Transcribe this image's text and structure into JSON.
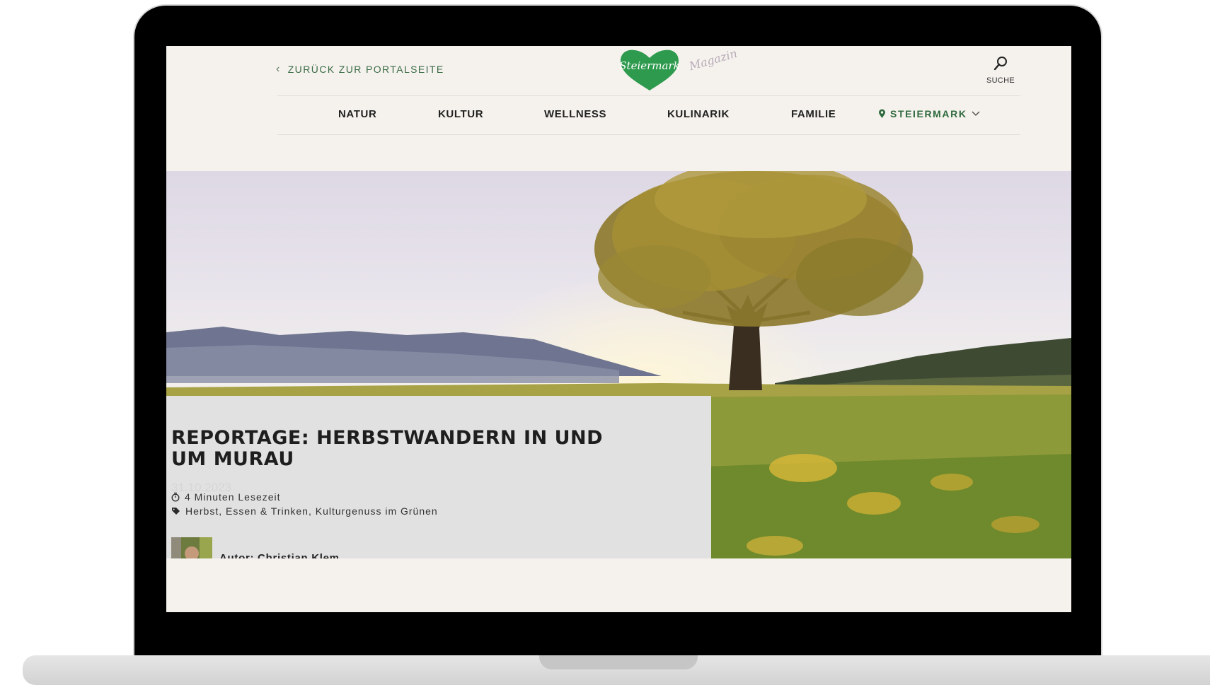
{
  "header": {
    "back_link": "ZURÜCK ZUR PORTALSEITE",
    "logo_text": "Steiermark",
    "logo_sub": "Magazin",
    "search_label": "SUCHE"
  },
  "nav": {
    "items": [
      {
        "label": "NATUR"
      },
      {
        "label": "KULTUR"
      },
      {
        "label": "WELLNESS"
      },
      {
        "label": "KULINARIK"
      },
      {
        "label": "FAMILIE"
      }
    ],
    "region": "STEIERMARK"
  },
  "article": {
    "title_line1": "REPORTAGE: HERBSTWANDERN IN UND",
    "title_line2": "UM MURAU",
    "date": "31.10.2023",
    "reading_time": "4 Minuten Lesezeit",
    "tags": "Herbst, Essen & Trinken, Kulturgenuss im Grünen",
    "author": "Autor: Christian Klem"
  },
  "colors": {
    "brand_green": "#2e9a4e",
    "background": "#f5f2ed",
    "panel": "#e1e1e1"
  }
}
